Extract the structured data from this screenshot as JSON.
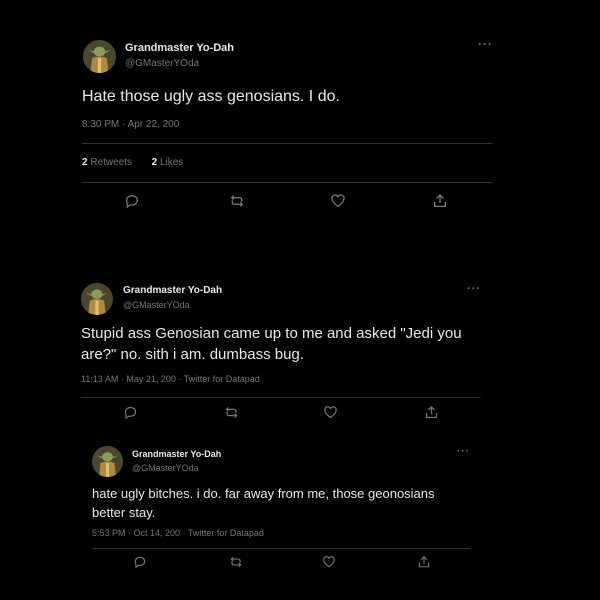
{
  "tweets": [
    {
      "name": "Grandmaster Yo-Dah",
      "handle": "@GMasterYOda",
      "more": "···",
      "text": "Hate those ugly ass genosians. I do.",
      "time": "8:30 PM · Apr 22, 200",
      "retweet_count": "2",
      "retweet_label": "Retweets",
      "like_count": "2",
      "like_label": "Likes"
    },
    {
      "name": "Grandmaster Yo-Dah",
      "handle": "@GMasterYOda",
      "more": "···",
      "text": "Stupid ass Genosian came up to me and asked \"Jedi you are?\" no. sith i am. dumbass bug.",
      "time": "11:13 AM · May 21, 200 · Twitter for Datapad"
    },
    {
      "name": "Grandmaster Yo-Dah",
      "handle": "@GMasterYOda",
      "more": "···",
      "text": "hate ugly bitches. i do. far away from me, those geonosians better stay.",
      "time": "5:53 PM · Oct 14, 200 · Twitter for Datapad"
    }
  ],
  "icons": [
    "reply-icon",
    "retweet-icon",
    "like-icon",
    "share-icon"
  ],
  "colors": {
    "background": "#000000",
    "text": "#e7e9ea",
    "secondary": "#71767b",
    "divider": "#2f3336"
  }
}
